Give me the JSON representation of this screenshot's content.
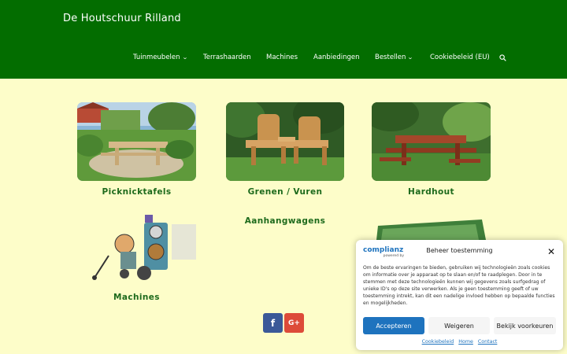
{
  "header": {
    "site_title": "De Houtschuur Rilland",
    "nav": [
      {
        "label": "Tuinmeubelen",
        "has_dropdown": true
      },
      {
        "label": "Terrashaarden",
        "has_dropdown": false
      },
      {
        "label": "Machines",
        "has_dropdown": false
      },
      {
        "label": "Aanbiedingen",
        "has_dropdown": false
      },
      {
        "label": "Bestellen",
        "has_dropdown": true
      },
      {
        "label": "Cookiebeleid (EU)",
        "has_dropdown": false
      }
    ],
    "search_icon": "search-icon",
    "bg_color": "#036d00"
  },
  "tiles": [
    {
      "label": "Picknicktafels"
    },
    {
      "label": "Grenen / Vuren"
    },
    {
      "label": "Hardhout"
    },
    {
      "label": "Machines"
    },
    {
      "label": "Aanhangwagens"
    }
  ],
  "social": {
    "facebook_icon": "facebook-icon",
    "google_icon": "google-plus-icon",
    "facebook_color": "#3b5998",
    "google_color": "#dd4b39",
    "facebook_glyph": "f",
    "google_glyph": "G+"
  },
  "consent": {
    "brand": "complianz",
    "brand_sub": "powered by",
    "title": "Beheer toestemming",
    "text": "Om de beste ervaringen te bieden, gebruiken wij technologieën zoals cookies om informatie over je apparaat op te slaan en/of te raadplegen. Door in te stemmen met deze technologieën kunnen wij gegevens zoals surfgedrag of unieke ID's op deze site verwerken. Als je geen toestemming geeft of uw toestemming intrekt, kan dit een nadelige invloed hebben op bepaalde functies en mogelijkheden.",
    "accept_label": "Accepteren",
    "deny_label": "Weigeren",
    "prefs_label": "Bekijk voorkeuren",
    "links": [
      "Cookiebeleid",
      "Home",
      "Contact"
    ],
    "accent_color": "#1e73be"
  }
}
